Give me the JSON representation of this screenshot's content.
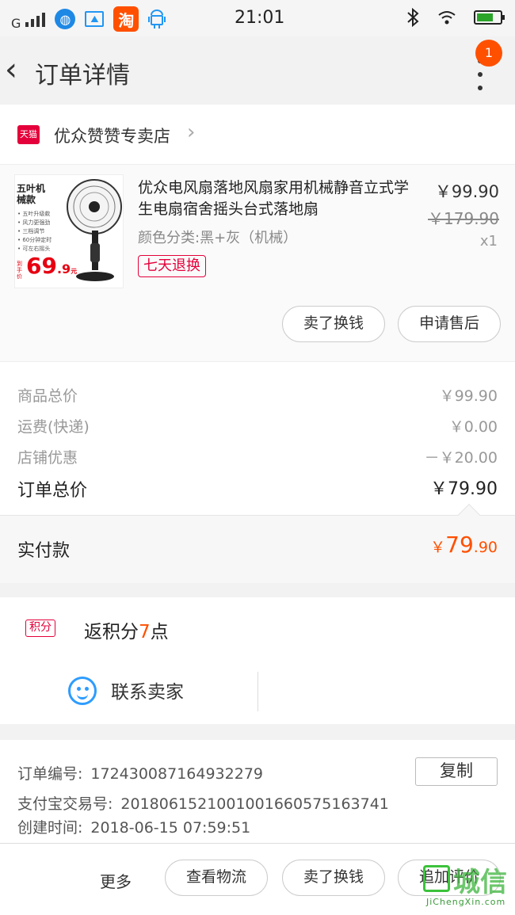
{
  "status_bar": {
    "carrier": "G",
    "time": "21:01",
    "apps": [
      {
        "icon": "browser-icon",
        "glyph": "◍",
        "color": "#1e88e5"
      },
      {
        "icon": "gallery-icon",
        "glyph": "⛰",
        "color": "#ffffff"
      },
      {
        "icon": "taobao-icon",
        "glyph": "淘",
        "color": "#ff5000"
      },
      {
        "icon": "android-icon",
        "glyph": "🤖",
        "color": "#ffffff"
      }
    ],
    "battery_level": 0.7
  },
  "nav": {
    "back_glyph": "‹",
    "title": "订单详情",
    "badge": "1"
  },
  "shop": {
    "tmall_label": "天猫",
    "name": "优众赞赞专卖店",
    "arrow": "›"
  },
  "product": {
    "image": {
      "headline": "五叶机械款",
      "features": [
        "• 五叶升级款",
        "• 风力更强劲",
        "• 三档调节",
        "• 60分钟定时",
        "• 可左右摇头"
      ],
      "promo_label": "到手价",
      "promo_price_big": "69",
      "promo_price_small": ".9",
      "promo_unit": "元"
    },
    "title": "优众电风扇落地风扇家用机械静音立式学生电扇宿舍摇头台式落地扇",
    "spec": "颜色分类:黑+灰（机械）",
    "return_tag": "七天退换",
    "price": "￥99.90",
    "original_price": "￥179.90",
    "quantity": "x1",
    "buttons": {
      "resell": "卖了换钱",
      "after_sale": "申请售后"
    }
  },
  "summary": {
    "rows": [
      {
        "label": "商品总价",
        "value": "￥99.90"
      },
      {
        "label": "运费(快递)",
        "value": "￥0.00"
      },
      {
        "label": "店铺优惠",
        "value": "－￥20.00"
      }
    ],
    "total_label": "订单总价",
    "total_value": "￥79.90"
  },
  "payment": {
    "label": "实付款",
    "currency": "￥",
    "amount_int": "79",
    "amount_dec": ".90",
    "accent": "#ff5000"
  },
  "points": {
    "tag": "积分",
    "text_prefix": "返积分",
    "count": "7",
    "text_suffix": "点"
  },
  "contact": {
    "label": "联系卖家"
  },
  "order_info": {
    "order_no_label": "订单编号:",
    "order_no": "172430087164932279",
    "copy_button": "复制",
    "alipay_label": "支付宝交易号:",
    "alipay_no": "2018061521001001660575163741",
    "created_label": "创建时间:",
    "created_time": "2018-06-15 07:59:51"
  },
  "bottom_bar": {
    "more": "更多",
    "logistics": "查看物流",
    "resell": "卖了换钱",
    "review": "追加评价"
  },
  "watermark": {
    "text": "城信",
    "url": "JiChengXin.com"
  }
}
